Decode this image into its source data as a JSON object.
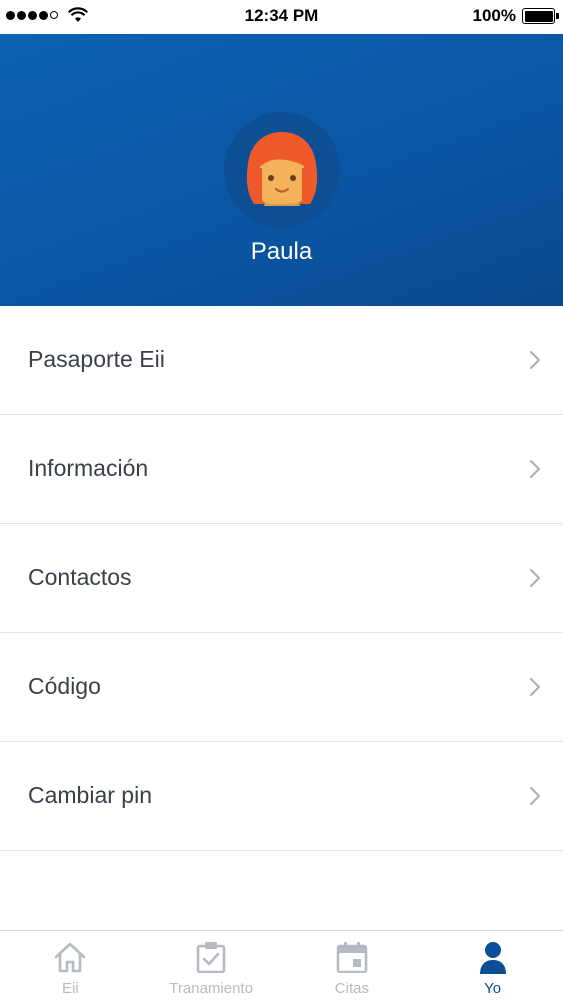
{
  "status_bar": {
    "time": "12:34 PM",
    "battery": "100%",
    "icons": [
      "signal-dots",
      "wifi-icon",
      "battery-icon"
    ]
  },
  "profile": {
    "name": "Paula",
    "avatar_icon": "woman-avatar-icon"
  },
  "menu": {
    "items": [
      {
        "label": "Pasaporte Eii"
      },
      {
        "label": "Información"
      },
      {
        "label": "Contactos"
      },
      {
        "label": "Código"
      },
      {
        "label": "Cambiar pin"
      }
    ]
  },
  "tab_bar": {
    "tabs": [
      {
        "label": "Eii",
        "icon": "home-icon"
      },
      {
        "label": "Tranamiento",
        "icon": "checklist-icon"
      },
      {
        "label": "Citas",
        "icon": "calendar-icon"
      },
      {
        "label": "Yo",
        "icon": "person-icon"
      }
    ],
    "active": "Yo"
  },
  "colors": {
    "header_blue": "#0a56a4",
    "active_tab": "#0b4f96",
    "inactive_tab": "#b6bac2",
    "hair": "#ef5a2a",
    "skin": "#f5b25a"
  }
}
